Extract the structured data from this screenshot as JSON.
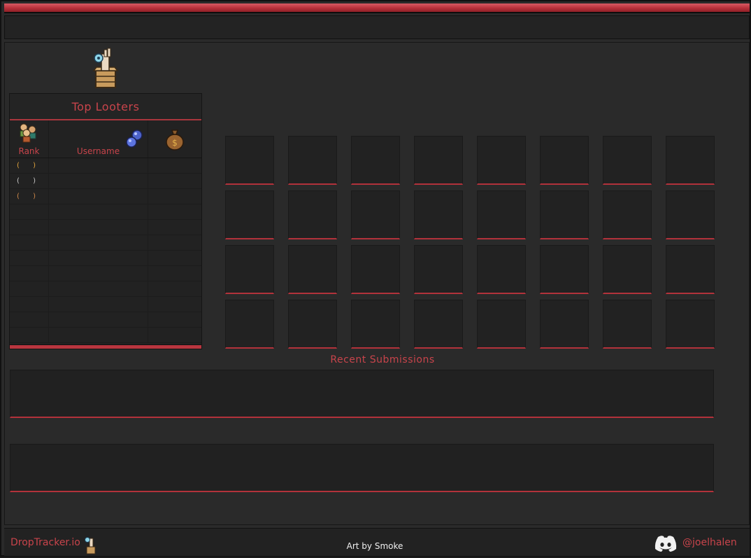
{
  "leaderboard": {
    "title": "Top Looters",
    "columns": {
      "rank": "Rank",
      "username": "Username",
      "value_icon": "money-bag-icon",
      "username_icon": "blue-orbs-icon",
      "rank_icon": "players-icon"
    },
    "rows": [
      {
        "rank": "( )",
        "username": "",
        "value": ""
      },
      {
        "rank": "( )",
        "username": "",
        "value": ""
      },
      {
        "rank": "( )",
        "username": "",
        "value": ""
      },
      {
        "rank": "",
        "username": "",
        "value": ""
      },
      {
        "rank": "",
        "username": "",
        "value": ""
      },
      {
        "rank": "",
        "username": "",
        "value": ""
      },
      {
        "rank": "",
        "username": "",
        "value": ""
      },
      {
        "rank": "",
        "username": "",
        "value": ""
      },
      {
        "rank": "",
        "username": "",
        "value": ""
      },
      {
        "rank": "",
        "username": "",
        "value": ""
      },
      {
        "rank": "",
        "username": "",
        "value": ""
      },
      {
        "rank": "",
        "username": "",
        "value": ""
      }
    ]
  },
  "loot_grid": {
    "rows": 4,
    "columns": 8
  },
  "recent_submissions": {
    "title": "Recent Submissions"
  },
  "footer": {
    "brand": "DropTracker.io",
    "credit": "Art by Smoke",
    "discord_handle": "@joelhalen",
    "discord_icon": "discord-icon"
  },
  "colors": {
    "accent": "#c8444b",
    "accent_bar": "#b2323b",
    "background": "#2a2a2a",
    "panel": "#222222",
    "rank_gold": "#e3a53d"
  }
}
